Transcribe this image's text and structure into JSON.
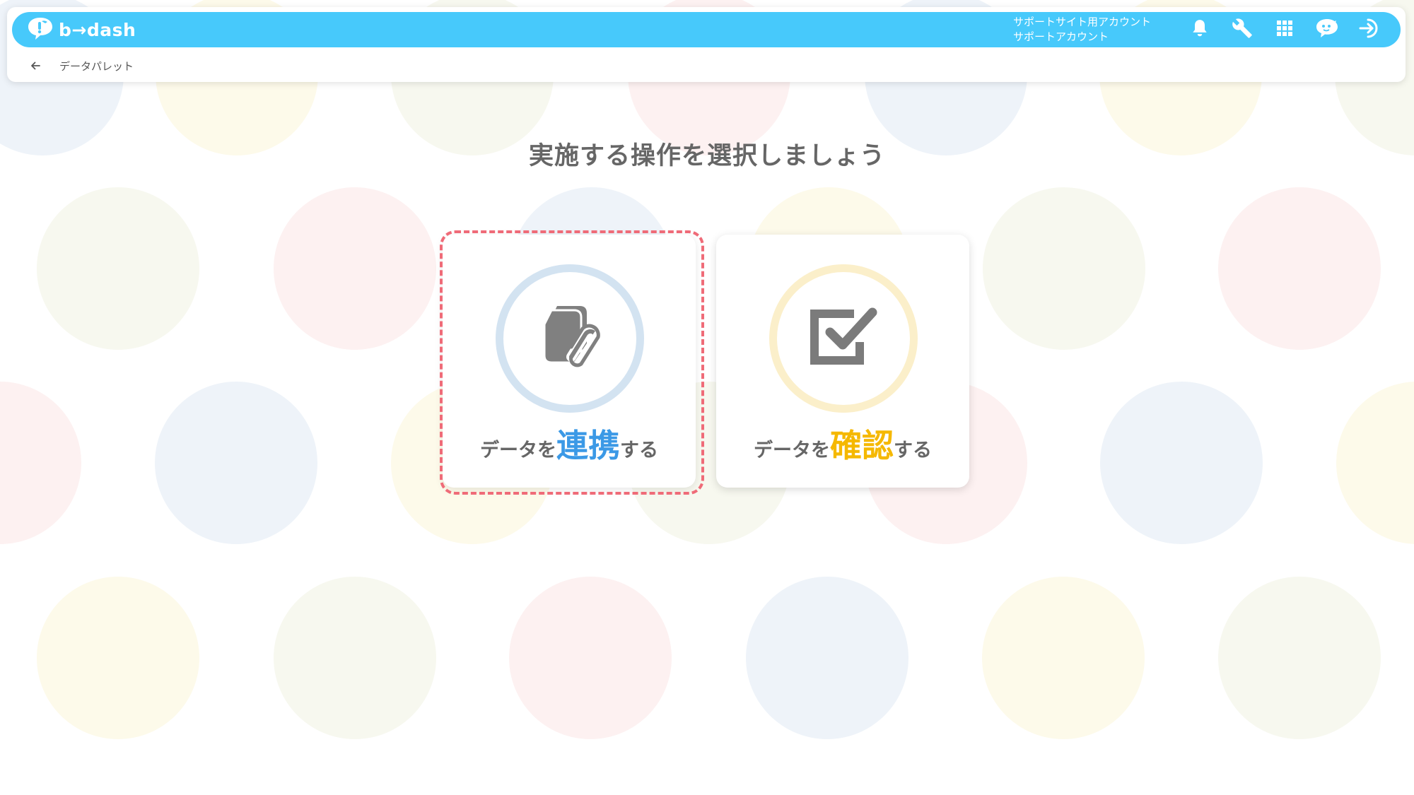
{
  "header": {
    "logo_text": "b→dash",
    "account_line1": "サポートサイト用アカウント",
    "account_line2": "サポートアカウント",
    "bar_color": "#47c9fb",
    "icons": [
      "bell-icon",
      "wrench-icon",
      "apps-grid-icon",
      "chat-bird-icon",
      "logout-icon"
    ]
  },
  "breadcrumb": {
    "back_icon": "arrow-left-icon",
    "label": "データパレット"
  },
  "main": {
    "title": "実施する操作を選択しましょう",
    "cards": [
      {
        "pre": "データを",
        "emphasis": "連携",
        "post": "する",
        "emphasis_color": "#3b99e6",
        "ring_color": "#d3e3f1",
        "icon": "linked-documents-icon",
        "selected": true
      },
      {
        "pre": "データを",
        "emphasis": "確認",
        "post": "する",
        "emphasis_color": "#f5b800",
        "ring_color": "#fbefca",
        "icon": "checkbox-check-icon",
        "selected": false
      }
    ]
  }
}
